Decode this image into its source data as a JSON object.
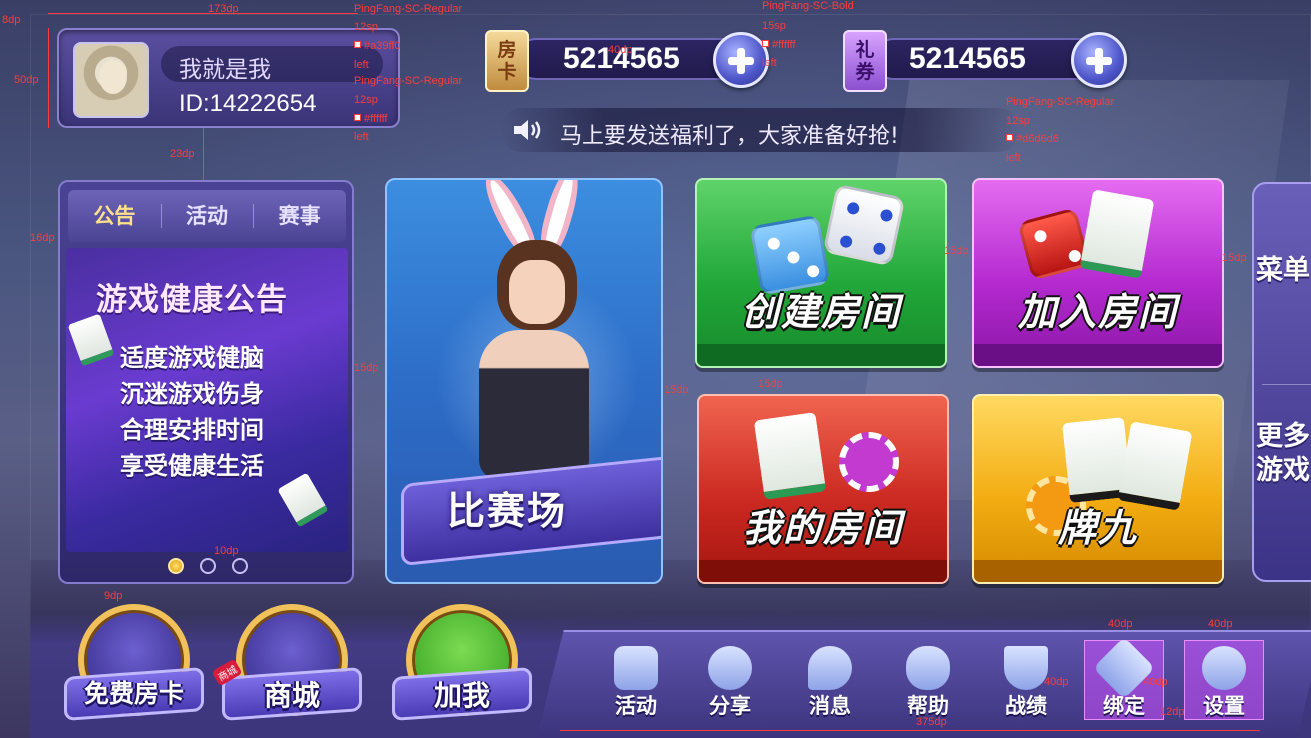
{
  "profile": {
    "name": "我就是我",
    "id": "ID:14222654"
  },
  "currency": {
    "room_card": {
      "badge": "房\n卡",
      "value": "5214565"
    },
    "coupon": {
      "badge": "礼\n券",
      "value": "5214565"
    }
  },
  "announcement": "马上要发送福利了，大家准备好抢!",
  "notice": {
    "tabs": [
      "公告",
      "活动",
      "赛事"
    ],
    "active_tab": "公告",
    "title": "游戏健康公告",
    "lines": [
      "适度游戏健脑",
      "沉迷游戏伤身",
      "合理安排时间",
      "享受健康生活"
    ],
    "page_count": 3,
    "current_page": 1
  },
  "arena": {
    "label": "比赛场"
  },
  "game_cards": {
    "create": "创建房间",
    "join": "加入房间",
    "mine": "我的房间",
    "cards": "牌九"
  },
  "side_menu": {
    "menu": "菜单",
    "more": "更多游戏"
  },
  "bottom": {
    "free_card": "免费房卡",
    "shop": "商城",
    "add_me": "加我",
    "shop_tag": "商城",
    "nav": [
      "活动",
      "分享",
      "消息",
      "帮助",
      "战绩",
      "绑定",
      "设置"
    ]
  },
  "annotations": {
    "dim_173": "173dp",
    "dim_8": "8dp",
    "dim_50": "50dp",
    "font_regular_1": "PingFang-SC-Regular",
    "size_12_1": "12sp",
    "color_1": "#a39ff0",
    "align_1": "left",
    "font_regular_2": "PingFang-SC-Regular",
    "size_12_2": "12sp",
    "color_2": "#ffffff",
    "align_2": "left",
    "dim_23": "23dp",
    "font_bold": "PingFang-SC-Bold",
    "size_15": "15sp",
    "color_3": "#ffffff",
    "align_3": "left",
    "dim_40_top": "40dp",
    "font_regular_3": "PingFang-SC-Regular",
    "size_12_3": "12sp",
    "color_4": "#d6d6d6",
    "align_4": "left",
    "dim_16": "16dp",
    "dim_15_a": "15dp",
    "dim_15_b": "15dp",
    "dim_15_c": "15dp",
    "dim_15_d": "15dp",
    "dim_15_e": "15dp",
    "dim_10": "10dp",
    "dim_9": "9dp",
    "dim_40_b1": "40dp",
    "dim_40_b2": "40dp",
    "dim_40_b3": "40dp",
    "dim_40_b4": "40dp",
    "dim_12": "12dp",
    "dim_375": "375dp"
  },
  "colors": {
    "accent_purple": "#5a4fa0",
    "tab_active": "#ffe18a",
    "annotation": "#ff3b3b"
  }
}
